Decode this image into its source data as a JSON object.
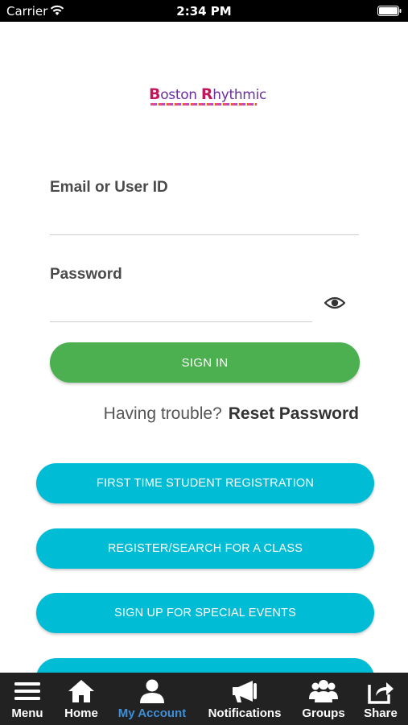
{
  "status_bar": {
    "carrier": "Carrier",
    "time": "2:34 PM"
  },
  "logo": {
    "text_b": "B",
    "text_oston": "oston ",
    "text_r": "R",
    "text_hythmic": "hythmic"
  },
  "login": {
    "email_label": "Email or User ID",
    "email_value": "",
    "password_label": "Password",
    "password_value": "",
    "sign_in_label": "SIGN IN",
    "trouble_text": "Having trouble?",
    "reset_label": "Reset Password"
  },
  "actions": [
    {
      "label": "FIRST TIME STUDENT REGISTRATION"
    },
    {
      "label": "REGISTER/SEARCH FOR A CLASS"
    },
    {
      "label": "SIGN UP FOR SPECIAL EVENTS"
    }
  ],
  "tabs": [
    {
      "label": "Menu",
      "icon": "menu-icon"
    },
    {
      "label": "Home",
      "icon": "home-icon"
    },
    {
      "label": "My Account",
      "icon": "account-icon",
      "active": true
    },
    {
      "label": "Notifications",
      "icon": "megaphone-icon"
    },
    {
      "label": "Groups",
      "icon": "groups-icon"
    },
    {
      "label": "Share",
      "icon": "share-icon"
    }
  ],
  "colors": {
    "sign_in": "#4caf50",
    "action": "#00bcd4",
    "tab_bar": "#222222",
    "tab_active": "#3f8ed8"
  }
}
